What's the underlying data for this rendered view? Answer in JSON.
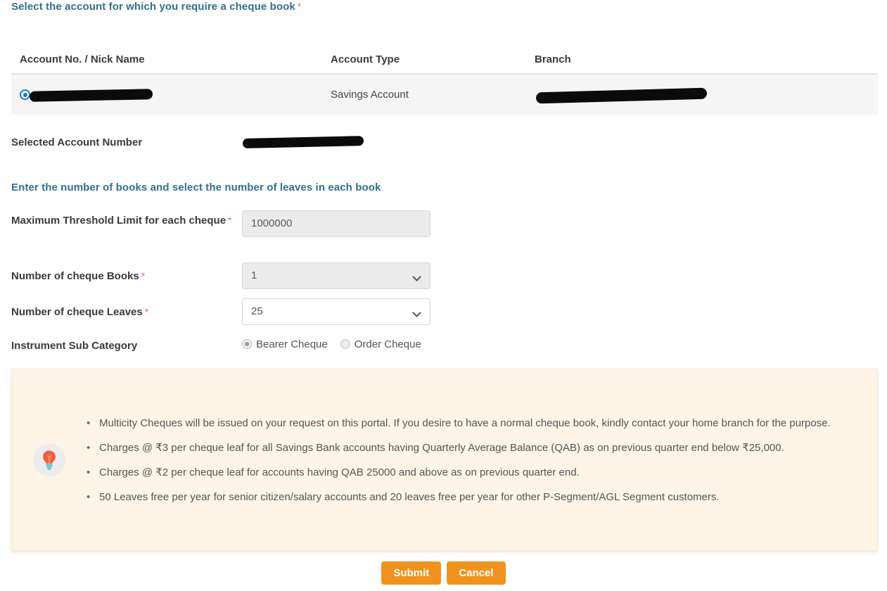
{
  "headings": {
    "select_account": "Select the account for which you require a cheque book",
    "enter_books": "Enter the number of books and select the number of leaves in each book",
    "required_mark": "*"
  },
  "accounts_table": {
    "columns": [
      "Account No. / Nick Name",
      "Account Type",
      "Branch"
    ],
    "rows": [
      {
        "account_no": "",
        "account_type": "Savings Account",
        "branch": "",
        "selected": true
      }
    ]
  },
  "selected_account": {
    "label": "Selected Account Number",
    "value": ""
  },
  "form": {
    "threshold": {
      "label": "Maximum Threshold Limit for each cheque",
      "value": "1000000",
      "required": "*",
      "disabled": true
    },
    "books": {
      "label": "Number of cheque Books",
      "value": "1",
      "required": "*",
      "disabled": true
    },
    "leaves": {
      "label": "Number of cheque Leaves",
      "value": "25",
      "required": "*",
      "disabled": false
    },
    "sub_category": {
      "label": "Instrument Sub Category",
      "options": [
        {
          "label": "Bearer Cheque",
          "selected": true
        },
        {
          "label": "Order Cheque",
          "selected": false
        }
      ]
    }
  },
  "info_panel": {
    "icon": "lightbulb-icon",
    "items": [
      "Multicity Cheques will be issued on your request on this portal. If you desire to have a normal cheque book, kindly contact your home branch for the purpose.",
      "Charges @ ₹3 per cheque leaf for all Savings Bank accounts having Quarterly Average Balance (QAB) as on previous quarter end below ₹25,000.",
      "Charges @ ₹2 per cheque leaf for accounts having QAB 25000 and above as on previous quarter end.",
      "50 Leaves free per year for senior citizen/salary accounts and 20 leaves free per year for other P-Segment/AGL Segment customers."
    ]
  },
  "buttons": {
    "submit": "Submit",
    "cancel": "Cancel"
  },
  "colors": {
    "heading_blue": "#31708f",
    "required_star": "#e8705a",
    "button_orange": "#f0921f",
    "info_bg": "#fdf4e7",
    "row_bg": "#f5f5f5",
    "radio_blue": "#1177dd"
  }
}
